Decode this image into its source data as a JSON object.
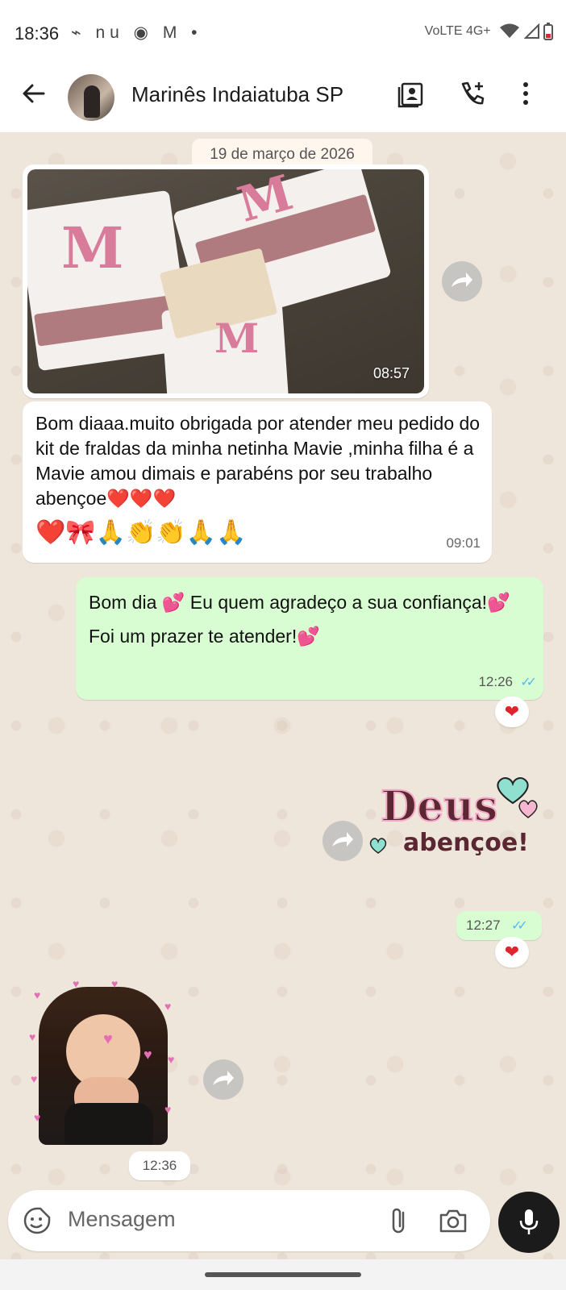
{
  "status_bar": {
    "time": "18:36",
    "left_icons": "⌁ nu ◉ M •",
    "right_text": "VoLTE 4G+"
  },
  "header": {
    "contact_name": "Marinês Indaiatuba SP"
  },
  "chat": {
    "date_chip": "19 de março de 2026",
    "image_message": {
      "time": "08:57"
    },
    "incoming_message": {
      "text": "Bom diaaa.muito obrigada por atender meu pedido  do kit  de fraldas da minha  netinha Mavie  ,minha filha  é a Mavie amou  dimais e parabéns por seu trabalho abençoe❤️❤️❤️",
      "emoji_line": "❤️🎀🙏👏👏🙏🙏",
      "time": "09:01"
    },
    "outgoing_message": {
      "line1": "Bom dia 💕 Eu quem agradeço a sua confiança!💕",
      "line2": "Foi um prazer te atender!💕",
      "time": "12:26",
      "reaction": "❤"
    },
    "sticker_deus": {
      "title": "Deus",
      "subtitle": "abençoe!",
      "time": "12:27",
      "reaction": "❤"
    },
    "sticker_girl": {
      "time": "12:36"
    }
  },
  "composer": {
    "placeholder": "Mensagem"
  },
  "colors": {
    "outgoing_bubble": "#d9fdd3",
    "incoming_bubble": "#ffffff",
    "read_ticks": "#53bdeb"
  }
}
